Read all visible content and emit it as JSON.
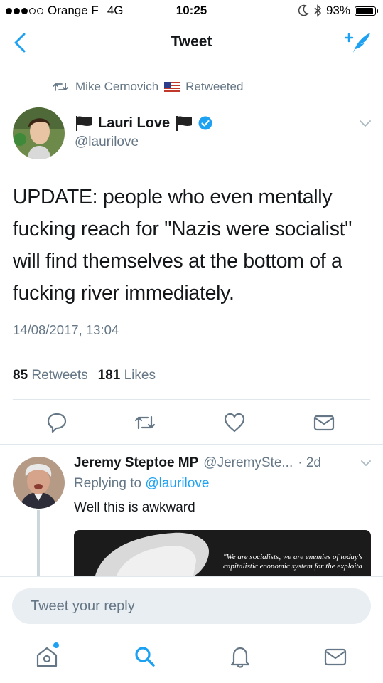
{
  "status_bar": {
    "carrier": "Orange F",
    "network": "4G",
    "time": "10:25",
    "battery_percent": "93%",
    "signal_bars_filled": 3,
    "signal_bars_total": 5,
    "battery_level": 0.93
  },
  "nav": {
    "title": "Tweet",
    "back_icon": "chevron-left-icon",
    "compose_icon": "compose-tweet-icon"
  },
  "retweet_context": {
    "retweeter": "Mike Cernovich",
    "label": "Retweeted"
  },
  "tweet": {
    "author_name": "Lauri Love",
    "author_handle": "@laurilove",
    "text": "UPDATE: people who even mentally fucking reach for \"Nazis were socialist\" will find themselves at the bottom of a fucking river immediately.",
    "timestamp": "14/08/2017, 13:04",
    "retweet_count": "85",
    "retweet_label": "Retweets",
    "like_count": "181",
    "like_label": "Likes"
  },
  "reply": {
    "author_name": "Jeremy Steptoe MP",
    "author_handle": "@JeremySte...",
    "age": "· 2d",
    "replying_prefix": "Replying to",
    "replying_to": "@laurilove",
    "text": "Well this is awkward",
    "media_quote": "\"We are socialists, we are enemies of today's capitalistic economic system for the exploita"
  },
  "composer": {
    "placeholder": "Tweet your reply"
  },
  "colors": {
    "accent": "#1da1f2",
    "secondary_text": "#657786",
    "divider": "#e1e8ed",
    "verified": "#1da1f2"
  }
}
